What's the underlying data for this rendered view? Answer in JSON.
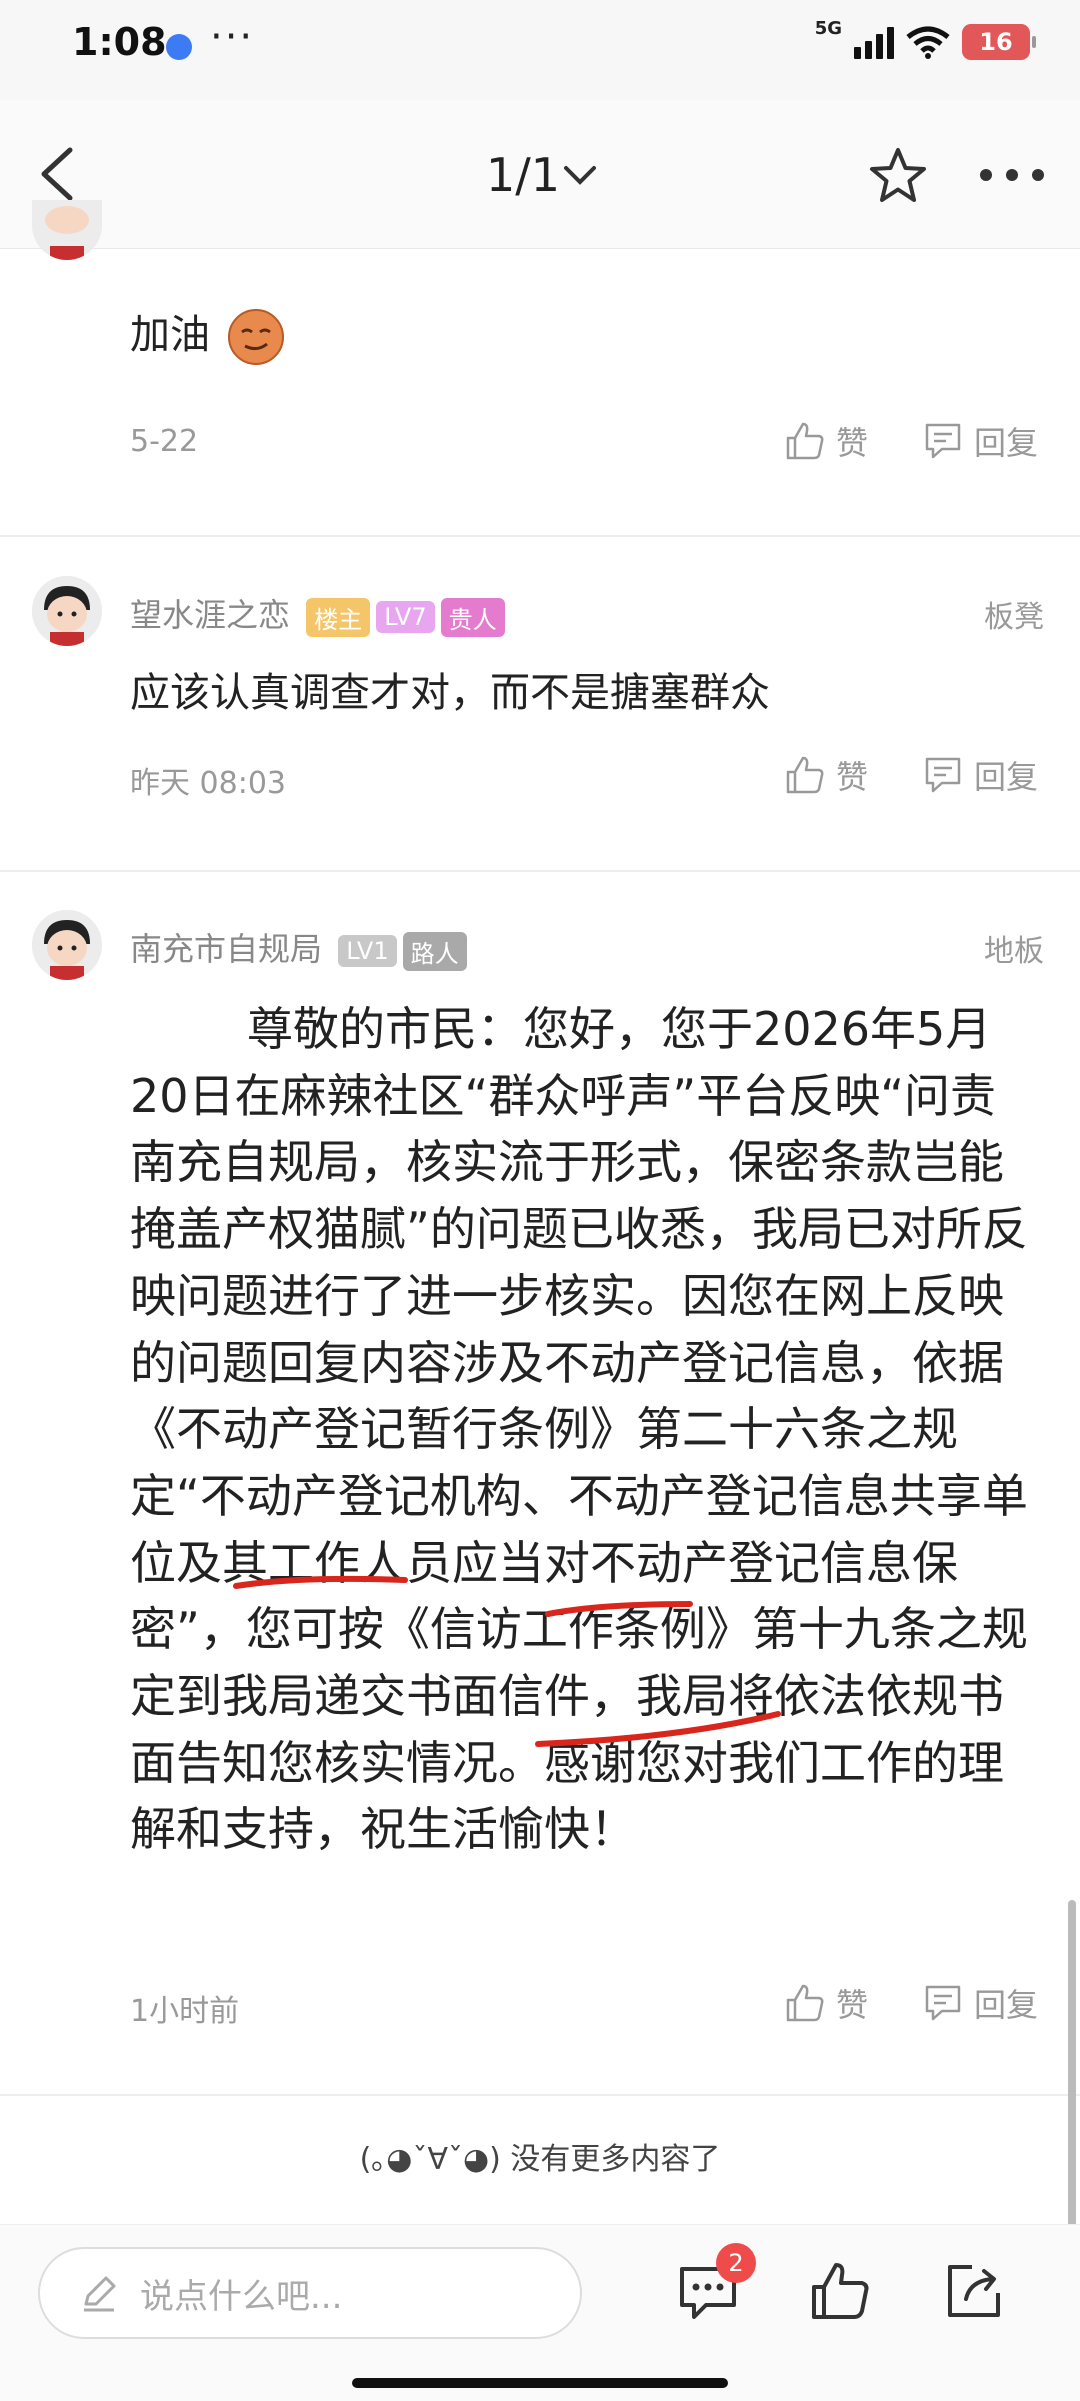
{
  "status": {
    "time": "1:08",
    "network": "5G",
    "battery": "16"
  },
  "nav": {
    "page_indicator": "1/1"
  },
  "comments": [
    {
      "text": "加油",
      "date": "5-22",
      "like_label": "赞",
      "reply_label": "回复"
    },
    {
      "username": "望水涯之恋",
      "badges": [
        "楼主",
        "LV7",
        "贵人"
      ],
      "floor": "板凳",
      "text": "应该认真调查才对，而不是搪塞群众",
      "date": "昨天 08:03",
      "like_label": "赞",
      "reply_label": "回复"
    },
    {
      "username": "南充市自规局",
      "badges": [
        "LV1",
        "路人"
      ],
      "floor": "地板",
      "text": "        尊敬的市民：您好，您于2026年5月20日在麻辣社区“群众呼声”平台反映“问责南充自规局，核实流于形式，保密条款岂能掩盖产权猫腻”的问题已收悉，我局已对所反映问题进行了进一步核实。因您在网上反映的问题回复内容涉及不动产登记信息，依据《不动产登记暂行条例》第二十六条之规定“不动产登记机构、不动产登记信息共享单位及其工作人员应当对不动产登记信息保密”，您可按《信访工作条例》第十九条之规定到我局递交书面信件，我局将依法依规书面告知您核实情况。感谢您对我们工作的理解和支持，祝生活愉快！",
      "date": "1小时前",
      "like_label": "赞",
      "reply_label": "回复"
    }
  ],
  "footer": {
    "end_text": "(｡◕ˇ∀ˇ◕) 没有更多内容了"
  },
  "bottom_bar": {
    "input_placeholder": "说点什么吧...",
    "comment_badge": "2"
  },
  "colors": {
    "owner_badge": "#f5c56a",
    "lv7_badge": "#e8a6f0",
    "guiren_badge": "#e57bcf",
    "gray_badge": "#c8c8c8",
    "annotation_red": "#d9261c"
  }
}
